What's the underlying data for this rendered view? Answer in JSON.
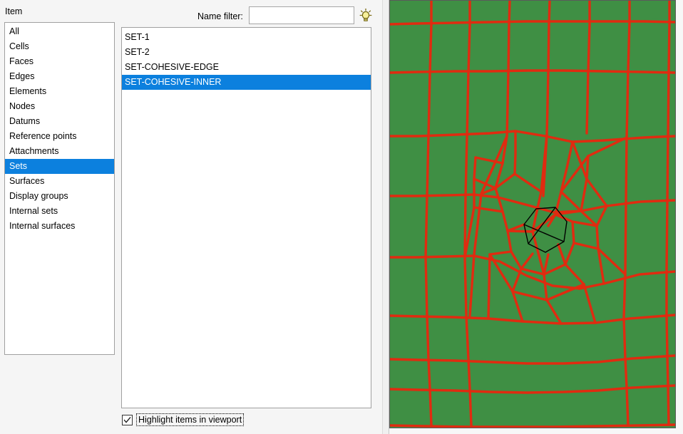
{
  "panel": {
    "item_label": "Item",
    "name_filter_label": "Name filter:",
    "name_filter_value": "",
    "name_filter_placeholder": "",
    "bulb_icon": "lightbulb-icon"
  },
  "item_list": {
    "selected": "Sets",
    "items": [
      {
        "label": "All",
        "selected": false
      },
      {
        "label": "Cells",
        "selected": false
      },
      {
        "label": "Faces",
        "selected": false
      },
      {
        "label": "Edges",
        "selected": false
      },
      {
        "label": "Elements",
        "selected": false
      },
      {
        "label": "Nodes",
        "selected": false
      },
      {
        "label": "Datums",
        "selected": false
      },
      {
        "label": "Reference points",
        "selected": false
      },
      {
        "label": "Attachments",
        "selected": false
      },
      {
        "label": "Sets",
        "selected": true
      },
      {
        "label": "Surfaces",
        "selected": false
      },
      {
        "label": "Display groups",
        "selected": false
      },
      {
        "label": "Internal sets",
        "selected": false
      },
      {
        "label": "Internal surfaces",
        "selected": false
      }
    ]
  },
  "sets_list": {
    "selected": "SET-COHESIVE-INNER",
    "items": [
      {
        "label": "SET-1",
        "selected": false
      },
      {
        "label": "SET-2",
        "selected": false
      },
      {
        "label": "SET-COHESIVE-EDGE",
        "selected": false
      },
      {
        "label": "SET-COHESIVE-INNER",
        "selected": true
      }
    ]
  },
  "highlight": {
    "label": "Highlight items in viewport",
    "checked": true,
    "check_icon": "checkmark-icon"
  },
  "viewport": {
    "mesh_color": "#e02b10",
    "face_color": "#3f8f44",
    "highlight_color": "#000000",
    "description": "finite-element quad mesh viewport with highlighted inner cohesive heptagon"
  },
  "colors": {
    "selection_blue": "#0c80de",
    "panel_background": "#f5f5f5",
    "list_background": "#ffffff",
    "mesh_red": "#e02b10",
    "mesh_green": "#3f8f44"
  }
}
